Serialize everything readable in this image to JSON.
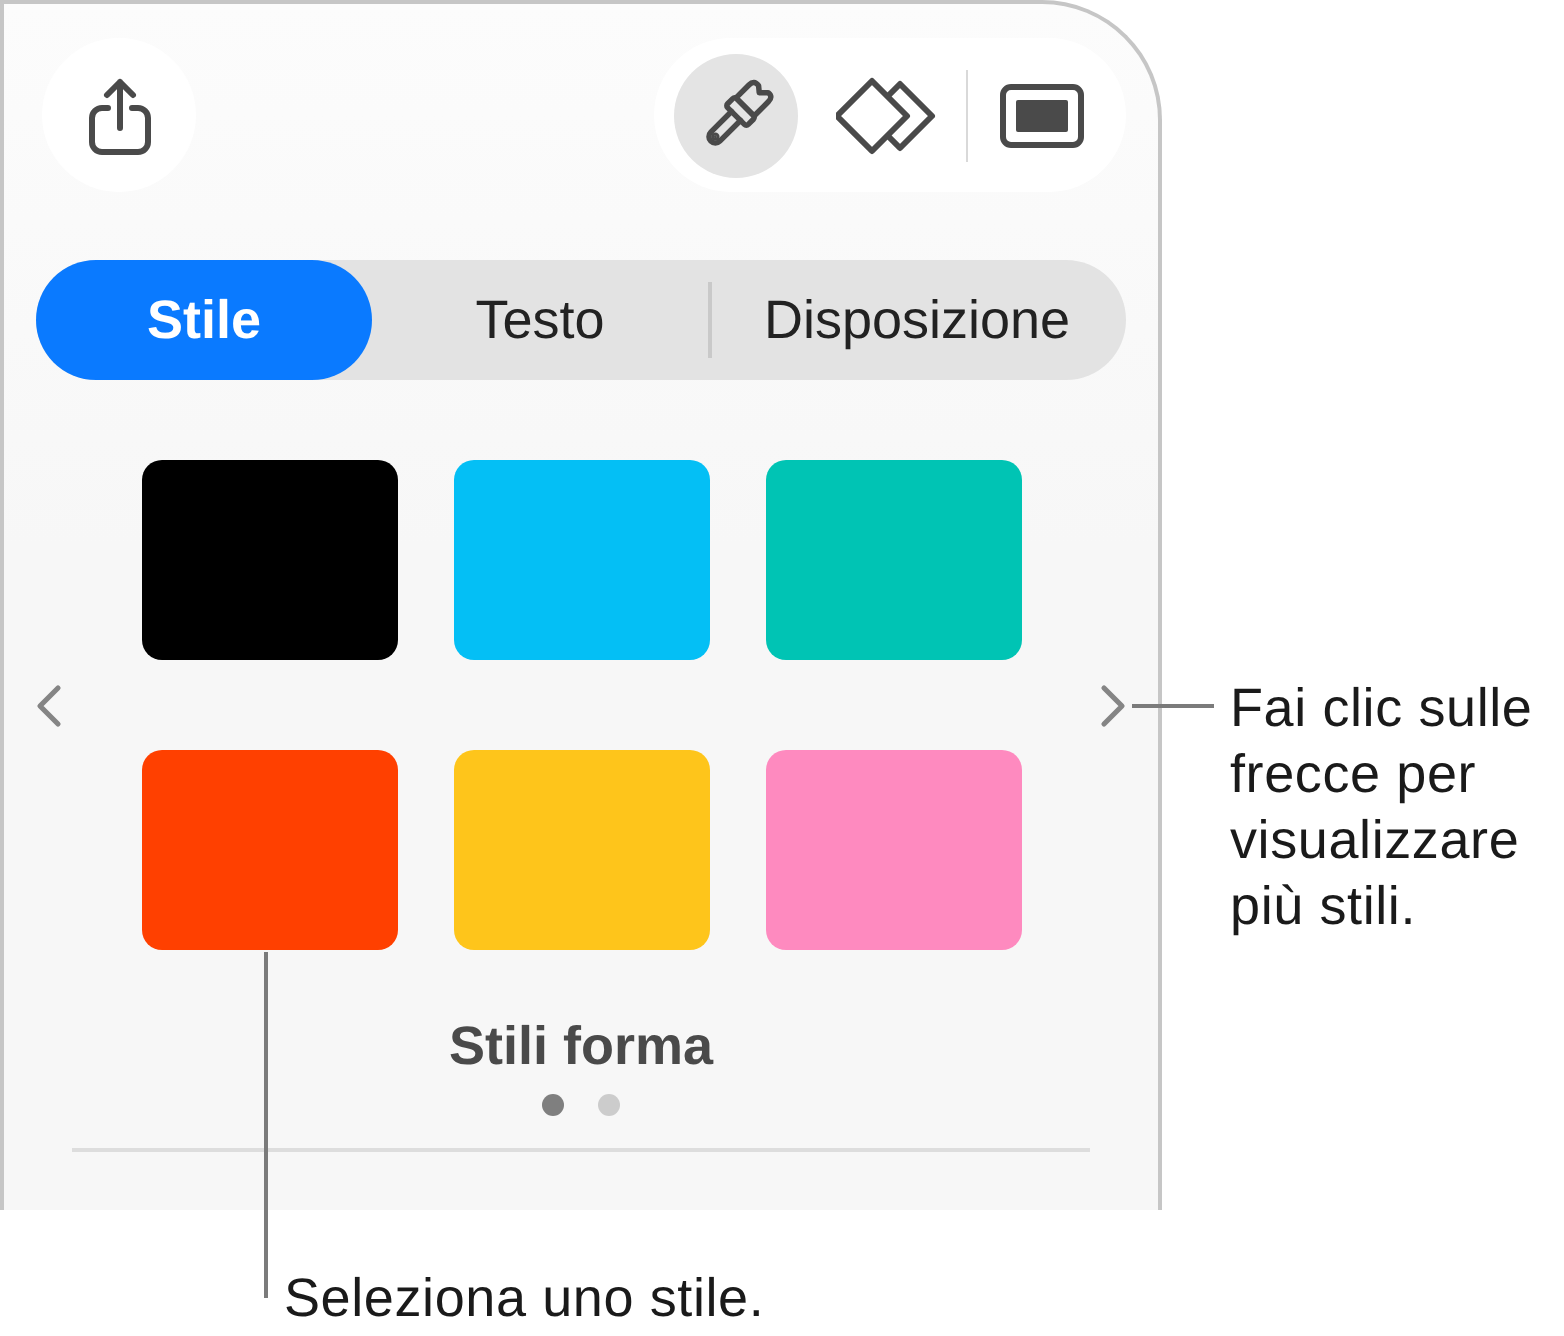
{
  "toolbar": {
    "buttons": [
      {
        "kind": "brush",
        "selected": true
      },
      {
        "kind": "shapes",
        "selected": false
      },
      {
        "kind": "screen",
        "selected": false
      }
    ]
  },
  "tabs": [
    {
      "label": "Stile",
      "selected": true
    },
    {
      "label": "Testo",
      "selected": false
    },
    {
      "label": "Disposizione",
      "selected": false
    }
  ],
  "shape_styles": {
    "swatches": [
      {
        "color": "#000000",
        "selected": false
      },
      {
        "color": "#04bff5",
        "selected": false
      },
      {
        "color": "#00c4b4",
        "selected": false
      },
      {
        "color": "#ff4000",
        "selected": false
      },
      {
        "color": "#fec51b",
        "selected": false
      },
      {
        "color": "#fe8abf",
        "selected": false
      }
    ],
    "title": "Stili forma",
    "pages": [
      {
        "selected": true
      },
      {
        "selected": false
      }
    ]
  },
  "callouts": [
    {
      "text": "Fai clic sulle frecce per visualizzare più stili."
    },
    {
      "text": "Seleziona uno stile."
    }
  ]
}
